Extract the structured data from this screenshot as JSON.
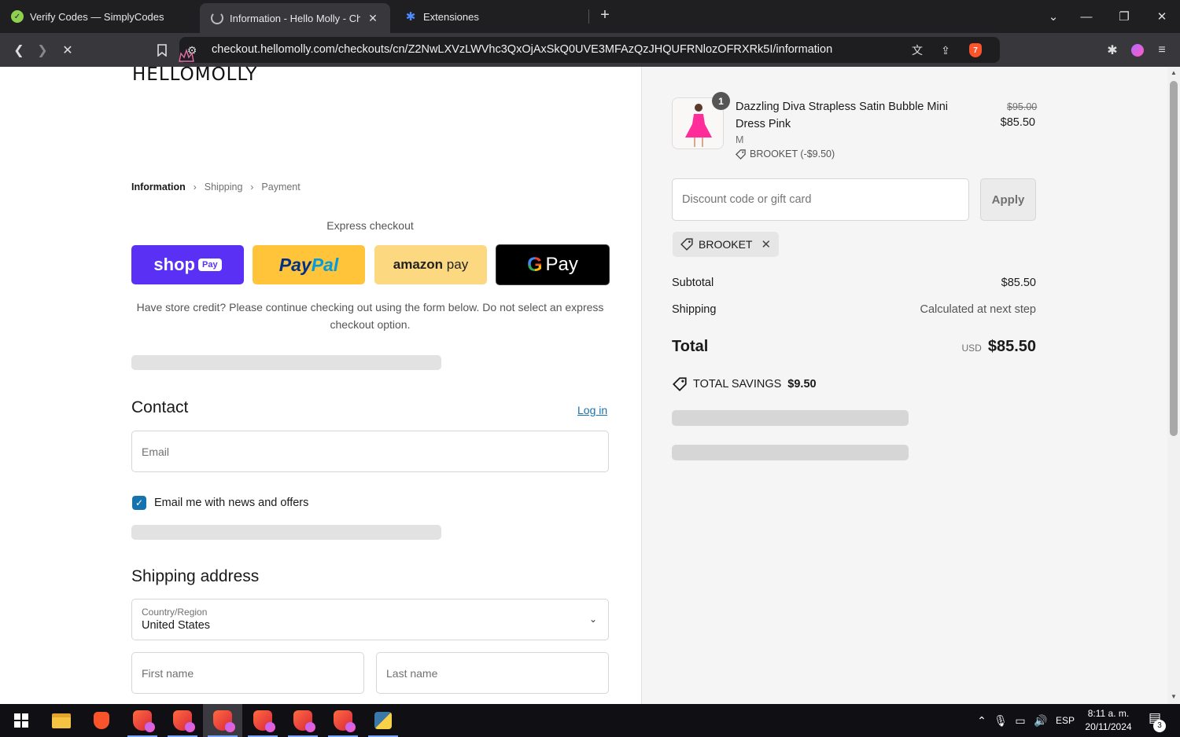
{
  "browser": {
    "tabs": [
      {
        "title": "Verify Codes — SimplyCodes"
      },
      {
        "title": "Information - Hello Molly - Checkout"
      },
      {
        "title": "Extensiones"
      }
    ],
    "url": "checkout.hellomolly.com/checkouts/cn/Z2NwLXVzLWVhc3QxOjAxSkQ0UVE3MFAzQzJHQUFRNlozOFRXRk5I/information",
    "shield_count": "7"
  },
  "checkout": {
    "logo_text": "HELLOMOLLY",
    "breadcrumb": {
      "information": "Information",
      "shipping": "Shipping",
      "payment": "Payment"
    },
    "express_label": "Express checkout",
    "express": {
      "shop": "shop",
      "shop_pill": "Pay",
      "paypal_a": "Pay",
      "paypal_b": "Pal",
      "amazon_a": "amazon",
      "amazon_b": "pay",
      "gpay_g": "G",
      "gpay_pay": "Pay"
    },
    "credit_note": "Have store credit? Please continue checking out using the form below. Do not select an express checkout option.",
    "contact": {
      "title": "Contact",
      "login": "Log in",
      "email_placeholder": "Email",
      "news_label": "Email me with news and offers"
    },
    "shipping": {
      "title": "Shipping address",
      "country_label": "Country/Region",
      "country_value": "United States",
      "first_name_placeholder": "First name",
      "last_name_placeholder": "Last name"
    }
  },
  "summary": {
    "item": {
      "qty": "1",
      "name": "Dazzling Diva Strapless Satin Bubble Mini Dress Pink",
      "variant": "M",
      "discount": "BROOKET (-$9.50)",
      "price_old": "$95.00",
      "price_new": "$85.50"
    },
    "discount_placeholder": "Discount code or gift card",
    "apply": "Apply",
    "applied_code": "BROOKET",
    "subtotal_label": "Subtotal",
    "subtotal_value": "$85.50",
    "shipping_label": "Shipping",
    "shipping_value": "Calculated at next step",
    "total_label": "Total",
    "currency": "USD",
    "total_value": "$85.50",
    "savings_label": "TOTAL SAVINGS",
    "savings_value": "$9.50"
  },
  "taskbar": {
    "lang": "ESP",
    "time": "8:11 a. m.",
    "date": "20/11/2024",
    "notifications": "3"
  }
}
